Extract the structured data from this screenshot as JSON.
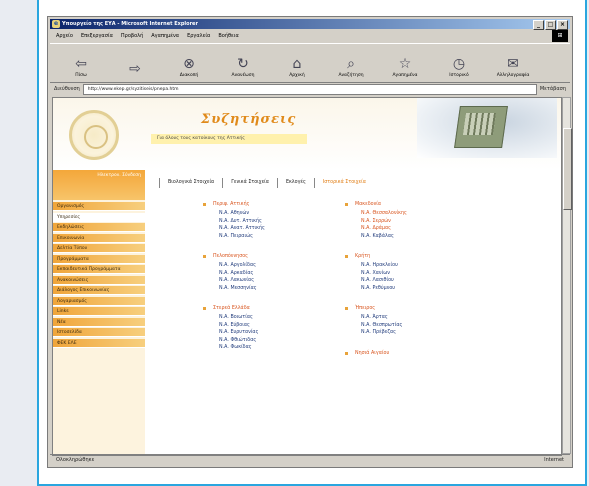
{
  "browser": {
    "title": "Υπουργείο της ΕΥΑ - Microsoft Internet Explorer",
    "menu": [
      "Αρχείο",
      "Επεξεργασία",
      "Προβολή",
      "Αγαπημένα",
      "Εργαλεία",
      "Βοήθεια"
    ],
    "toolbar": [
      "Πίσω",
      "",
      "Διακοπή",
      "Ανανέωση",
      "Αρχική",
      "Αναζήτηση",
      "Αγαπημένα",
      "Ιστορικό",
      "Αλληλογραφία"
    ],
    "address_label": "Διεύθυνση",
    "address_value": "http://www.ekep.gr/syzitiseis/pnepa.htm",
    "go_label": "Μετάβαση",
    "status_left": "Ολοκληρώθηκε",
    "status_right": "Internet",
    "window_buttons": [
      "_",
      "□",
      "×"
    ]
  },
  "site": {
    "title": "Συζητήσεις",
    "tagline": "Για όλους τους κατοίκους της Αττικής",
    "sidebar_head": "Ηλεκτρον. Σύνδεση",
    "sidebar": [
      "Οργανισμός",
      "Υπηρεσίες",
      "Εκδηλώσεις",
      "Επικοινωνία",
      "Δελτία Τύπου",
      "Προγράμματα",
      "Εκπαιδευτικά Προγράμματα",
      "Ανακοινώσεις",
      "Διάλογος Επικοινωνίας",
      "Λογαριασμός",
      "Links",
      "Νέα",
      "Ιστοσελίδα",
      "ΦΕΚ ΕΛΕ"
    ],
    "sidebar_active": 1,
    "tabs": [
      "Βιολογικά Στοιχεία",
      "Γενικά Στοιχεία",
      "Εκλογές",
      "Ιστορικά Στοιχεία"
    ],
    "left_col": [
      {
        "h": "Περιφ. Αττικής",
        "items": [
          "Ν.Α. Αθηνών",
          "Ν.Α. Δυτ. Αττικής",
          "Ν.Α. Ανατ. Αττικής",
          "Ν.Α. Πειραιώς"
        ]
      },
      {
        "h": "Πελοπόννησος",
        "items": [
          "Ν.Α. Αργολίδας",
          "Ν.Α. Αρκαδίας",
          "Ν.Α. Λακωνίας",
          "Ν.Α. Μεσσηνίας"
        ]
      },
      {
        "h": "Στερεά Ελλάδα",
        "items": [
          "Ν.Α. Βοιωτίας",
          "Ν.Α. Εύβοιας",
          "Ν.Α. Ευρυτανίας",
          "Ν.Α. Φθιώτιδας",
          "Ν.Α. Φωκίδας"
        ]
      }
    ],
    "right_col": [
      {
        "h": "Μακεδονία",
        "items": [
          "Ν.Α. Θεσσαλονίκης",
          "Ν.Α. Σερρών",
          "Ν.Α. Δράμας",
          "Ν.Α. Καβάλας"
        ],
        "red": [
          0,
          1,
          2
        ]
      },
      {
        "h": "Κρήτη",
        "items": [
          "Ν.Α. Ηρακλείου",
          "Ν.Α. Χανίων",
          "Ν.Α. Λασιθίου",
          "Ν.Α. Ρεθύμνου"
        ],
        "red": []
      },
      {
        "h": "Ήπειρος",
        "items": [
          "Ν.Α. Άρτας",
          "Ν.Α. Θεσπρωτίας",
          "Ν.Α. Πρέβεζας"
        ],
        "red": []
      },
      {
        "h": "Νησιά Αιγαίου",
        "items": [],
        "red": []
      }
    ]
  }
}
